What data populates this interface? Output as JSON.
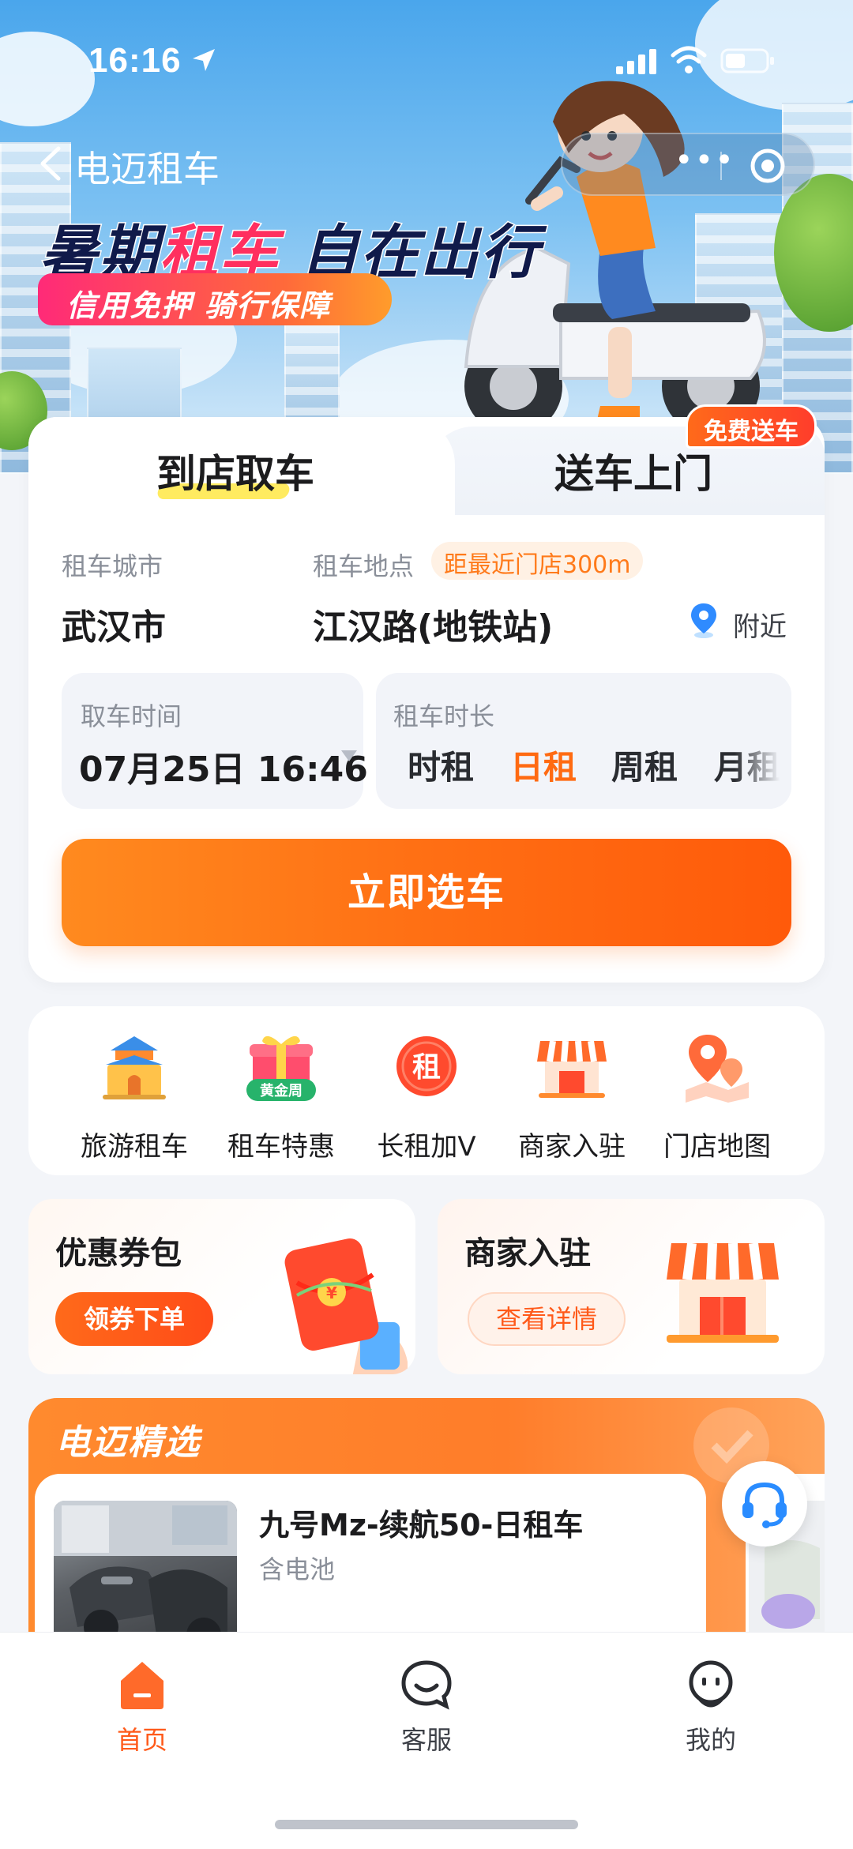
{
  "status_bar": {
    "time": "16:16"
  },
  "nav": {
    "title": "电迈租车",
    "more": "•••"
  },
  "banner": {
    "title_part1": "暑期",
    "title_highlight": "租车",
    "title_part2": "自在出行",
    "subtitle": "信用免押 骑行保障"
  },
  "booking": {
    "tabs": [
      {
        "label": "到店取车",
        "active": true
      },
      {
        "label": "送车上门",
        "active": false
      }
    ],
    "free_delivery_badge": "免费送车",
    "city_label": "租车城市",
    "city_value": "武汉市",
    "location_label": "租车地点",
    "nearest_store_tag": "距最近门店300m",
    "location_value": "江汉路(地铁站)",
    "nearby_label": "附近",
    "pickup_time_label": "取车时间",
    "pickup_time_value": "07月25日 16:46",
    "duration_label": "租车时长",
    "duration_options": [
      {
        "label": "时租",
        "active": false
      },
      {
        "label": "日租",
        "active": true
      },
      {
        "label": "周租",
        "active": false
      },
      {
        "label": "月租",
        "active": false
      }
    ],
    "select_button": "立即选车"
  },
  "quick_actions": [
    {
      "label": "旅游租车",
      "icon": "travel-gate-icon"
    },
    {
      "label": "租车特惠",
      "icon": "gift-box-icon",
      "badge": "黄金周"
    },
    {
      "label": "长租加V",
      "icon": "rent-badge-icon",
      "glyph": "租"
    },
    {
      "label": "商家入驻",
      "icon": "storefront-icon"
    },
    {
      "label": "门店地图",
      "icon": "map-pin-icon"
    }
  ],
  "promos": [
    {
      "title": "优惠券包",
      "button": "领券下单"
    },
    {
      "title": "商家入驻",
      "button": "查看详情"
    }
  ],
  "picks": {
    "title": "电迈精选",
    "items": [
      {
        "name": "九号Mz-续航50-日租车",
        "sub": "含电池"
      }
    ]
  },
  "tabbar": [
    {
      "label": "首页",
      "active": true
    },
    {
      "label": "客服",
      "active": false
    },
    {
      "label": "我的",
      "active": false
    }
  ],
  "colors": {
    "accent": "#ff6a12",
    "accent_dark": "#ff5a0a",
    "title_navy": "#101a4a",
    "highlight_pink": "#ff2f5f"
  }
}
